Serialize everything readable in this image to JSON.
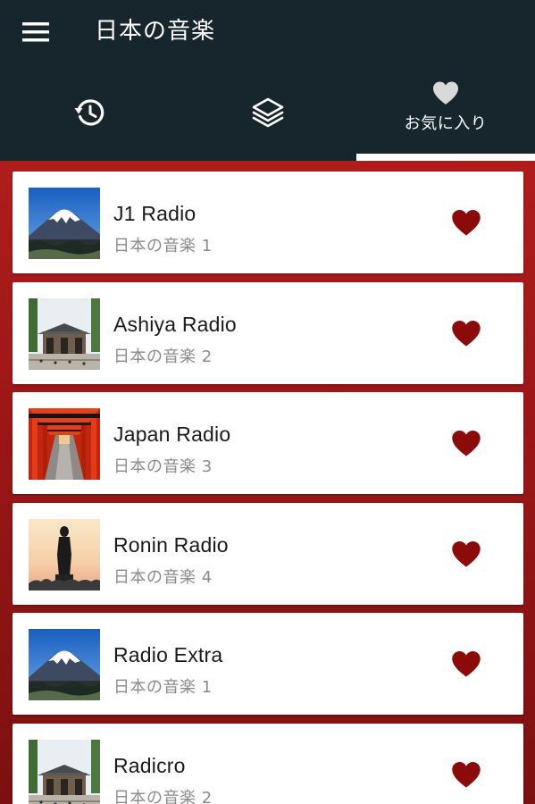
{
  "app": {
    "title": "日本の音楽"
  },
  "tabs": [
    {
      "icon": "history-icon",
      "label": "",
      "active": false
    },
    {
      "icon": "layers-icon",
      "label": "",
      "active": false
    },
    {
      "icon": "heart-icon",
      "label": "お気に入り",
      "active": true
    }
  ],
  "colors": {
    "toolbar": "#17252d",
    "list_background": "#a11818",
    "favorite_heart": "#8b0a0a"
  },
  "stations": [
    {
      "name": "J1 Radio",
      "genre": "日本の音楽 1",
      "image": "mount-fuji",
      "favorite": true
    },
    {
      "name": "Ashiya Radio",
      "genre": "日本の音楽 2",
      "image": "temple-gate",
      "favorite": true
    },
    {
      "name": "Japan Radio",
      "genre": "日本の音楽 3",
      "image": "torii-tunnel",
      "favorite": true
    },
    {
      "name": "Ronin Radio",
      "genre": "日本の音楽 4",
      "image": "buddha-statue-sunset",
      "favorite": true
    },
    {
      "name": "Radio Extra",
      "genre": "日本の音楽 1",
      "image": "mount-fuji",
      "favorite": true
    },
    {
      "name": "Radicro",
      "genre": "日本の音楽 2",
      "image": "temple-gate",
      "favorite": true
    }
  ]
}
